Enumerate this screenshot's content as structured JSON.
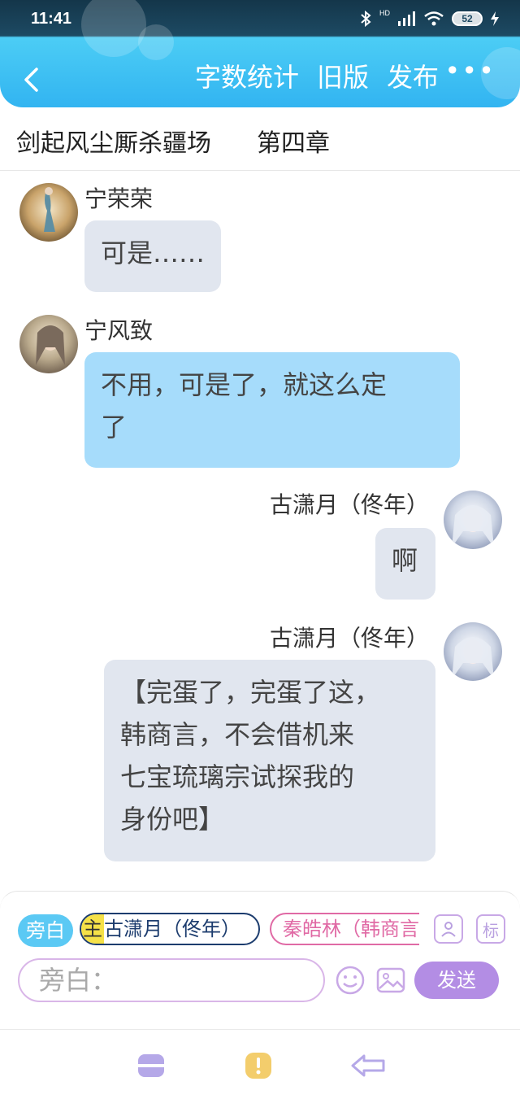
{
  "status_bar": {
    "time": "11:41",
    "battery": "52",
    "icons": [
      "bluetooth-icon",
      "signal-icon",
      "wifi-icon",
      "battery-icon",
      "charging-icon"
    ],
    "network_label": "HD"
  },
  "nav": {
    "back_icon": "chevron-left-icon",
    "actions": [
      "字数统计",
      "旧版",
      "发布"
    ],
    "more": "•••"
  },
  "subtitle": {
    "book_title": "剑起风尘厮杀疆场",
    "chapter": "第四章"
  },
  "messages": [
    {
      "sender": "宁荣荣",
      "text": "可是……",
      "side": "left",
      "style": "gray"
    },
    {
      "sender": "宁风致",
      "text_lines": [
        "不用，可是了，就这么定",
        "了"
      ],
      "side": "left",
      "style": "blue"
    },
    {
      "sender": "古潇月（佟年）",
      "text": "啊",
      "side": "right",
      "style": "gray"
    },
    {
      "sender": "古潇月（佟年）",
      "text_lines": [
        "【完蛋了，完蛋了这，",
        "韩商言，不会借机来",
        "七宝琉璃宗试探我的",
        "身份吧】"
      ],
      "side": "right",
      "style": "gray"
    }
  ],
  "panel": {
    "roles": {
      "narration": "旁白",
      "main_tag": "主",
      "main_name": "古潇月（佟年）",
      "other_name": "秦皓林（韩商言"
    },
    "role_icons": [
      "contact-icon",
      "tag-icon"
    ],
    "tag_label": "标",
    "input_placeholder": "旁白：",
    "send_label": "发送"
  },
  "bottom_nav": [
    "menu-icon",
    "notice-icon",
    "back-arrow-icon"
  ],
  "colors": {
    "header_blue": "#32b4f1",
    "bubble_blue": "#a6dcfb",
    "bubble_gray": "#e1e6ef",
    "send_purple": "#b38de4",
    "chip_pink": "#e06aa5",
    "chip_navy": "#1c3c6e"
  }
}
